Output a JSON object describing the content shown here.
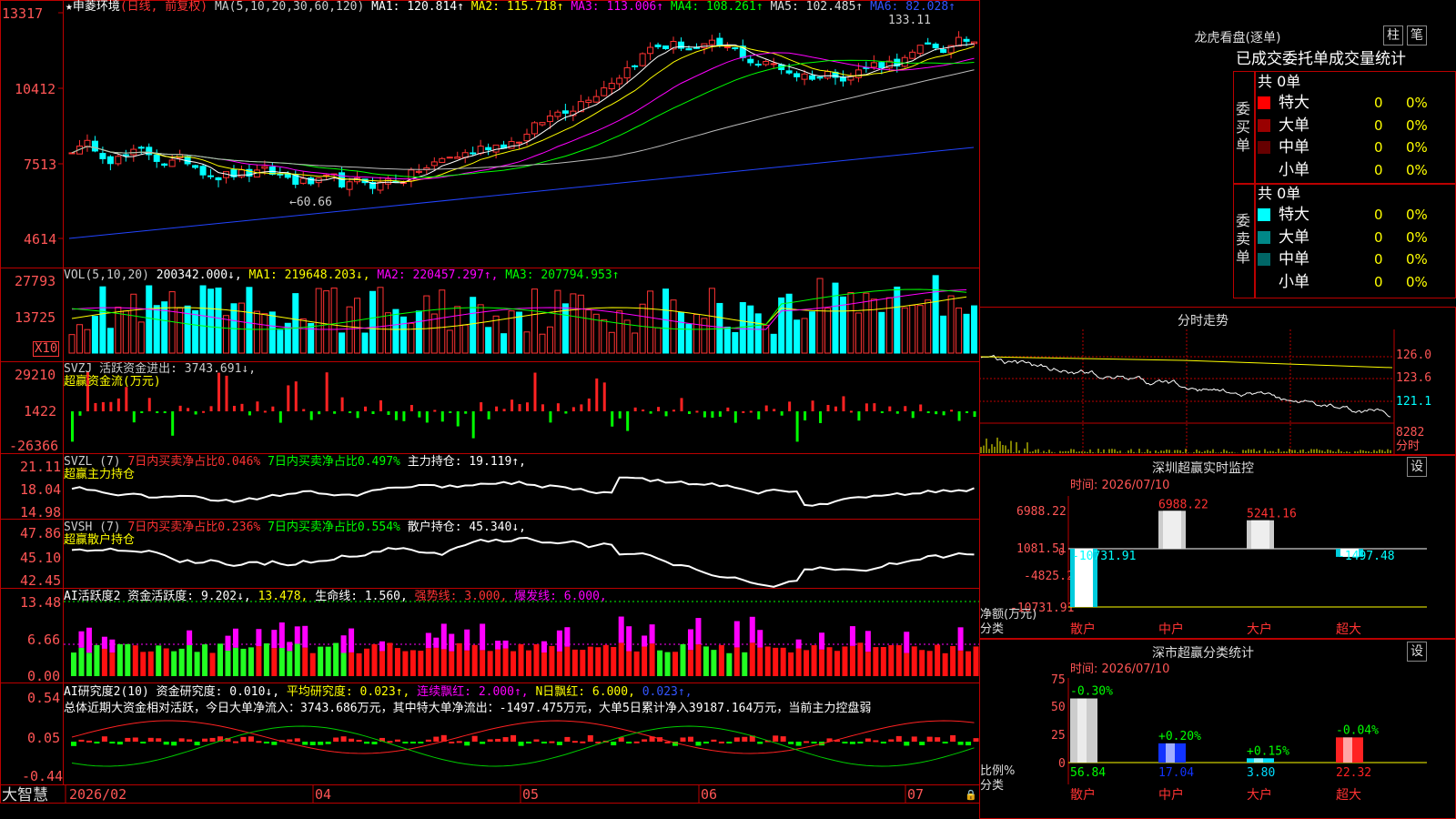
{
  "app": {
    "name": "大智慧"
  },
  "stock": {
    "title": "★申菱环境",
    "mode": "(日线, 前复权)",
    "ma_label": "MA(5,10,20,30,60,120)",
    "ma": [
      {
        "label": "MA1: 120.814↑",
        "color": "#ffffff"
      },
      {
        "label": "MA2: 115.718↑",
        "color": "#ffff00"
      },
      {
        "label": "MA3: 113.006↑",
        "color": "#ff00ff"
      },
      {
        "label": "MA4: 108.261↑",
        "color": "#00ff00"
      },
      {
        "label": "MA5: 102.485↑",
        "color": "#bbbbbb"
      },
      {
        "label": "MA6: 82.028↑",
        "color": "#2244ff"
      }
    ],
    "price_axis": [
      "13317",
      "10412",
      "7513",
      "4614"
    ],
    "high_note": "133.11",
    "low_note": "←60.66"
  },
  "vol": {
    "label": "VOL(5,10,20)",
    "value": "200342.000↓,",
    "ma": [
      {
        "label": "MA1: 219648.203↓,",
        "color": "#ffff00"
      },
      {
        "label": "MA2: 220457.297↑,",
        "color": "#ff00ff"
      },
      {
        "label": "MA3: 207794.953↑",
        "color": "#00ff00"
      }
    ],
    "axis": [
      "27793",
      "13725"
    ],
    "multiplier": "X10"
  },
  "svzj": {
    "label": "SVZJ  活跃资金进出: 3743.691↓,",
    "sub": "超赢资金流(万元)",
    "axis": [
      "29210",
      "1422",
      "-26366"
    ]
  },
  "svzl": {
    "label": "SVZL (7)",
    "p1": "7日内买卖净占比0.046%",
    "p2": "7日内买卖净占比0.497%",
    "p3": "主力持仓: 19.119↑,",
    "sub": "超赢主力持仓",
    "axis": [
      "21.11",
      "18.04",
      "14.98"
    ]
  },
  "svsh": {
    "label": "SVSH (7)",
    "p1": "7日内买卖净占比0.236%",
    "p2": "7日内买卖净占比0.554%",
    "p3": "散户持仓: 45.340↓,",
    "sub": "超赢散户持仓",
    "axis": [
      "47.86",
      "45.10",
      "42.45"
    ]
  },
  "ai1": {
    "label": "AI活跃度2 资金活跃度: 9.202↓,",
    "v2": "13.478,",
    "v3": "生命线: 1.560,",
    "v4": "强势线: 3.000,",
    "v5": "爆发线: 6.000,",
    "axis": [
      "13.48",
      "6.66",
      "0.00"
    ]
  },
  "ai2": {
    "label": "AI研究度2(10) 资金研究度: 0.010↓,",
    "v2": "平均研究度: 0.023↑,",
    "v3": "连续飘红: 2.000↑,",
    "v4": "N日飘红: 6.000,",
    "v5": "0.023↑,",
    "summary": "总体近期大资金相对活跃，今日大单净流入：3743.686万元，其中特大单净流出：-1497.475万元，大单5日累计净入39187.164万元，当前主力控盘弱",
    "axis": [
      "0.54",
      "0.05",
      "-0.44"
    ]
  },
  "dates": [
    "2026/02",
    "04",
    "05",
    "06",
    "07"
  ],
  "lhb": {
    "title": "龙虎看盘(逐单)",
    "btn1": "柱",
    "btn2": "笔",
    "header": "已成交委托单成交量统计",
    "buy_label": "委买单",
    "sell_label": "委卖单",
    "buy_total": "共 0单",
    "sell_total": "共 0单",
    "buy_rows": [
      {
        "name": "特大",
        "count": "0",
        "pct": "0%",
        "color": "#ff0000"
      },
      {
        "name": "大单",
        "count": "0",
        "pct": "0%",
        "color": "#990000"
      },
      {
        "name": "中单",
        "count": "0",
        "pct": "0%",
        "color": "#660000"
      },
      {
        "name": "小单",
        "count": "0",
        "pct": "0%",
        "color": ""
      }
    ],
    "sell_rows": [
      {
        "name": "特大",
        "count": "0",
        "pct": "0%",
        "color": "#00ffff"
      },
      {
        "name": "大单",
        "count": "0",
        "pct": "0%",
        "color": "#008888"
      },
      {
        "name": "中单",
        "count": "0",
        "pct": "0%",
        "color": "#006666"
      },
      {
        "name": "小单",
        "count": "0",
        "pct": "0%",
        "color": ""
      }
    ]
  },
  "intraday": {
    "title": "分时走势",
    "axis": [
      "126.0",
      "123.6",
      "121.1",
      "8282",
      "分时"
    ]
  },
  "sz_monitor": {
    "title": "深圳超赢实时监控",
    "btn": "设",
    "time": "时间: 2026/07/10",
    "axis": [
      "6988.22",
      "1081.51",
      "-4825.2",
      "-10731.91"
    ],
    "ylabel1": "净额(万元)",
    "ylabel2": "分类",
    "cats": [
      "散户",
      "中户",
      "大户",
      "超大"
    ],
    "values": [
      -10731.91,
      6988.22,
      5241.16,
      -1497.48
    ],
    "labels": [
      "-10731.91",
      "6988.22",
      "5241.16",
      "-1497.48"
    ],
    "zero": "0"
  },
  "sz_class": {
    "title": "深市超赢分类统计",
    "btn": "设",
    "time": "时间: 2026/07/10",
    "axis": [
      "75",
      "50",
      "25",
      "0"
    ],
    "ylabel1": "比例%",
    "ylabel2": "分类",
    "cats": [
      "散户",
      "中户",
      "大户",
      "超大"
    ],
    "values": [
      56.84,
      17.04,
      3.8,
      22.32
    ],
    "bottom_labels": [
      "56.84",
      "17.04",
      "3.80",
      "22.32"
    ],
    "top_labels": [
      "-0.30%",
      "+0.20%",
      "+0.15%",
      "-0.04%"
    ]
  }
}
